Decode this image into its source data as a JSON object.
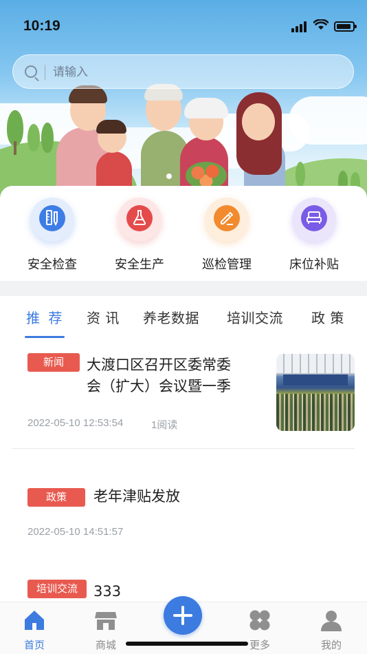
{
  "status_bar": {
    "time": "10:19"
  },
  "search": {
    "placeholder": "请输入"
  },
  "quick_actions": [
    {
      "label": "安全检查",
      "icon": "ruler-pencil-icon",
      "color": "#3e7de6"
    },
    {
      "label": "安全生产",
      "icon": "flask-icon",
      "color": "#e54b4b"
    },
    {
      "label": "巡检管理",
      "icon": "edit-note-icon",
      "color": "#f28a2e"
    },
    {
      "label": "床位补贴",
      "icon": "bed-icon",
      "color": "#7a5be6"
    }
  ],
  "tabs": [
    {
      "label": "推 荐",
      "active": true
    },
    {
      "label": "资 讯",
      "active": false
    },
    {
      "label": "养老数据",
      "active": false
    },
    {
      "label": "培训交流",
      "active": false
    },
    {
      "label": "政 策",
      "active": false
    }
  ],
  "news": [
    {
      "tag": "新闻",
      "title_line1": "大渡口区召开区委常委",
      "title_line2": "会（扩大）会议暨一季",
      "date": "2022-05-10 12:53:54",
      "reads": "1阅读",
      "has_thumbnail": true
    },
    {
      "tag": "政策",
      "title": "老年津贴发放",
      "date": "2022-05-10 14:51:57"
    },
    {
      "tag": "培训交流",
      "title": "333"
    }
  ],
  "bottom_nav": [
    {
      "label": "首页",
      "icon": "home-icon",
      "active": true
    },
    {
      "label": "商城",
      "icon": "shop-icon",
      "active": false
    },
    {
      "label": "",
      "icon": "plus-icon",
      "active": false
    },
    {
      "label": "更多",
      "icon": "clover-icon",
      "active": false
    },
    {
      "label": "我的",
      "icon": "user-icon",
      "active": false
    }
  ],
  "colors": {
    "accent": "#3c7be0",
    "tag_red": "#e85a4f"
  }
}
